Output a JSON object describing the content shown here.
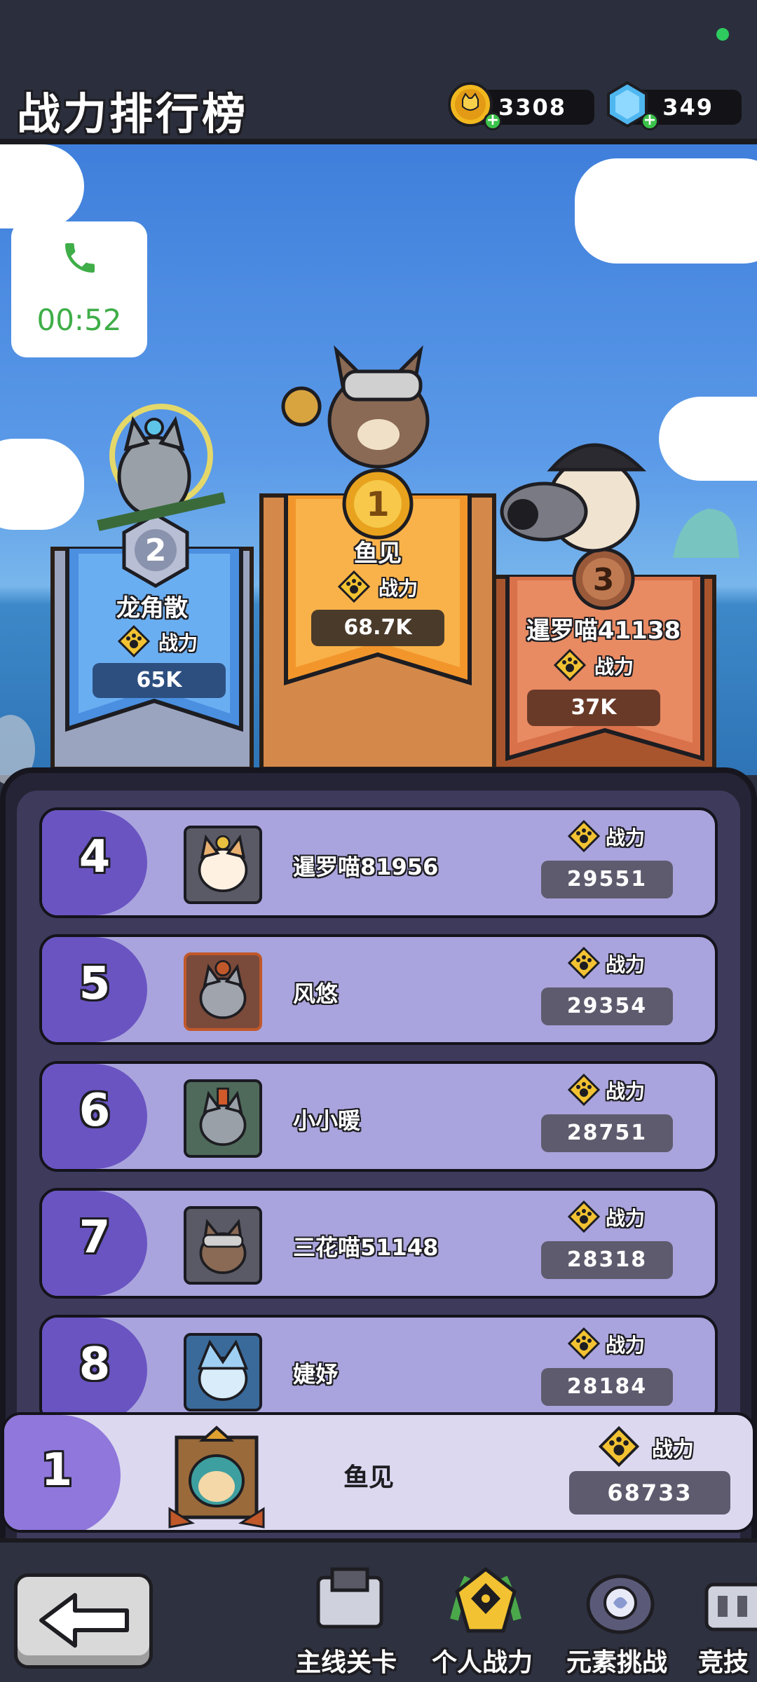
{
  "header": {
    "title": "战力排行榜",
    "coins": "3308",
    "gems": "349"
  },
  "call": {
    "time": "00:52"
  },
  "podium": [
    {
      "rank": "2",
      "name": "龙角散",
      "label": "战力",
      "value": "65K",
      "color": "#4a8fe0"
    },
    {
      "rank": "1",
      "name": "鱼见",
      "label": "战力",
      "value": "68.7K",
      "color": "#f2962c"
    },
    {
      "rank": "3",
      "name": "暹罗喵41138",
      "label": "战力",
      "value": "37K",
      "color": "#d9714a"
    }
  ],
  "list": [
    {
      "rank": "4",
      "name": "暹罗喵81956",
      "label": "战力",
      "value": "29551"
    },
    {
      "rank": "5",
      "name": "风悠",
      "label": "战力",
      "value": "29354"
    },
    {
      "rank": "6",
      "name": "小小暖",
      "label": "战力",
      "value": "28751"
    },
    {
      "rank": "7",
      "name": "三花喵51148",
      "label": "战力",
      "value": "28318"
    },
    {
      "rank": "8",
      "name": "婕妤",
      "label": "战力",
      "value": "28184"
    }
  ],
  "me": {
    "rank": "1",
    "name": "鱼见",
    "label": "战力",
    "value": "68733"
  },
  "nav": [
    {
      "label": "主线关卡",
      "icon": "map-scroll-icon"
    },
    {
      "label": "个人战力",
      "icon": "paw-badge-icon"
    },
    {
      "label": "元素挑战",
      "icon": "element-orb-icon"
    },
    {
      "label": "竞技",
      "icon": "colosseum-icon"
    }
  ],
  "colors": {
    "accent_purple": "#6a54c2",
    "row_bg": "#a9a4dd",
    "gold": "#f2c232"
  }
}
